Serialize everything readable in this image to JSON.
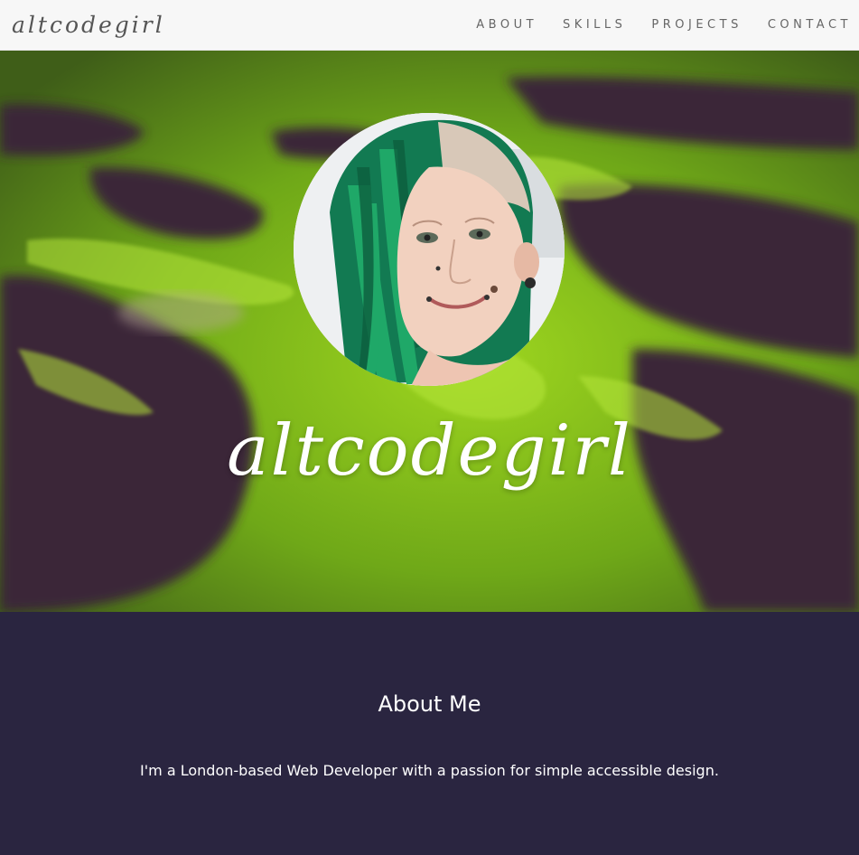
{
  "navbar": {
    "brand": "altcodegirl",
    "links": [
      {
        "label": "ABOUT"
      },
      {
        "label": "SKILLS"
      },
      {
        "label": "PROJECTS"
      },
      {
        "label": "CONTACT"
      }
    ]
  },
  "hero": {
    "title": "altcodegirl",
    "avatar": "profile-photo"
  },
  "about": {
    "heading": "About Me",
    "text": "I'm a London-based Web Developer with a passion for simple accessible design."
  },
  "colors": {
    "navbar_bg": "#f7f7f7",
    "moss_green": "#8cc21a",
    "rock_purple": "#3b2537",
    "about_bg": "#2a2540",
    "hair_green": "#1f9a5a"
  }
}
